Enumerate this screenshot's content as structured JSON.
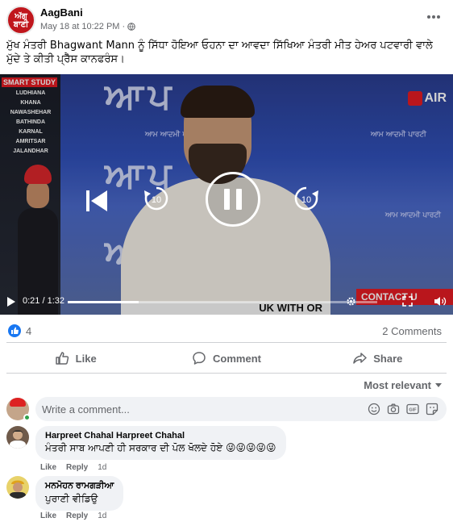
{
  "post": {
    "page_name": "AagBani",
    "logo_text": "ਅੱਗ ਬਾਣੀ",
    "timestamp": "May 18 at 10:22 PM",
    "separator": "·",
    "caption": "ਮੁੱਖ ਮੰਤਰੀ Bhagwant Mann ਨੂੰ ਸਿੱਧਾ ਹੋਇਆ ਓਹਨਾ ਦਾ ਆਵਦਾ ਸਿੱਖਿਆ ਮੰਤਰੀ ਮੀਤ ਹੇਅਰ ਪਟਵਾਰੀ ਵਾਲੇ ਮੁੱਦੇ ਤੇ ਕੀਤੀ ਪ੍ਰੈੱਸ ਕਾਨਫਰੰਸ।"
  },
  "video": {
    "banner_text": "ਆਪ",
    "banner_sub": "ਆਮ ਆਦਮੀ ਪਾਰਟੀ",
    "left_logo": "SMART STUDY",
    "cities": [
      "LUDHIANA",
      "KHANA",
      "NAWASHEHAR",
      "BATHINDA",
      "KARNAL",
      "AMRITSAR",
      "JALANDHAR"
    ],
    "channel_logo": "AIR",
    "contact_label": "CONTACT U",
    "ticker_text": "UK WITH OR",
    "current_time": "0:21",
    "duration": "1:32",
    "time_separator": " / ",
    "progress": 0.23
  },
  "stats": {
    "reactions_count": "4",
    "comments_count": "2 Comments"
  },
  "actions": {
    "like": "Like",
    "comment": "Comment",
    "share": "Share"
  },
  "sort": {
    "label": "Most relevant"
  },
  "comment_box": {
    "placeholder": "Write a comment..."
  },
  "comments": [
    {
      "author": "Harpreet Chahal Harpreet Chahal",
      "text": "ਮੰਤਰੀ ਸਾਬ ਆਪਣੀ ਹੀ ਸਰਕਾਰ ਦੀ ਪੋਲ ਖੋਲਦੇ ਹੋਏ 😜😜😜😜😜",
      "like": "Like",
      "reply": "Reply",
      "age": "1d"
    },
    {
      "author": "ਮਨਮੋਹਨ ਰਾਮਗੜੀਆ",
      "text": "ਪੁਰਾਣੀ ਵੀਡਿਉ",
      "like": "Like",
      "reply": "Reply",
      "age": "1d"
    }
  ],
  "colors": {
    "brand_blue": "#1877f2",
    "secondary_text": "#65676b",
    "bubble_bg": "#f0f2f5",
    "online_green": "#31a24c"
  }
}
